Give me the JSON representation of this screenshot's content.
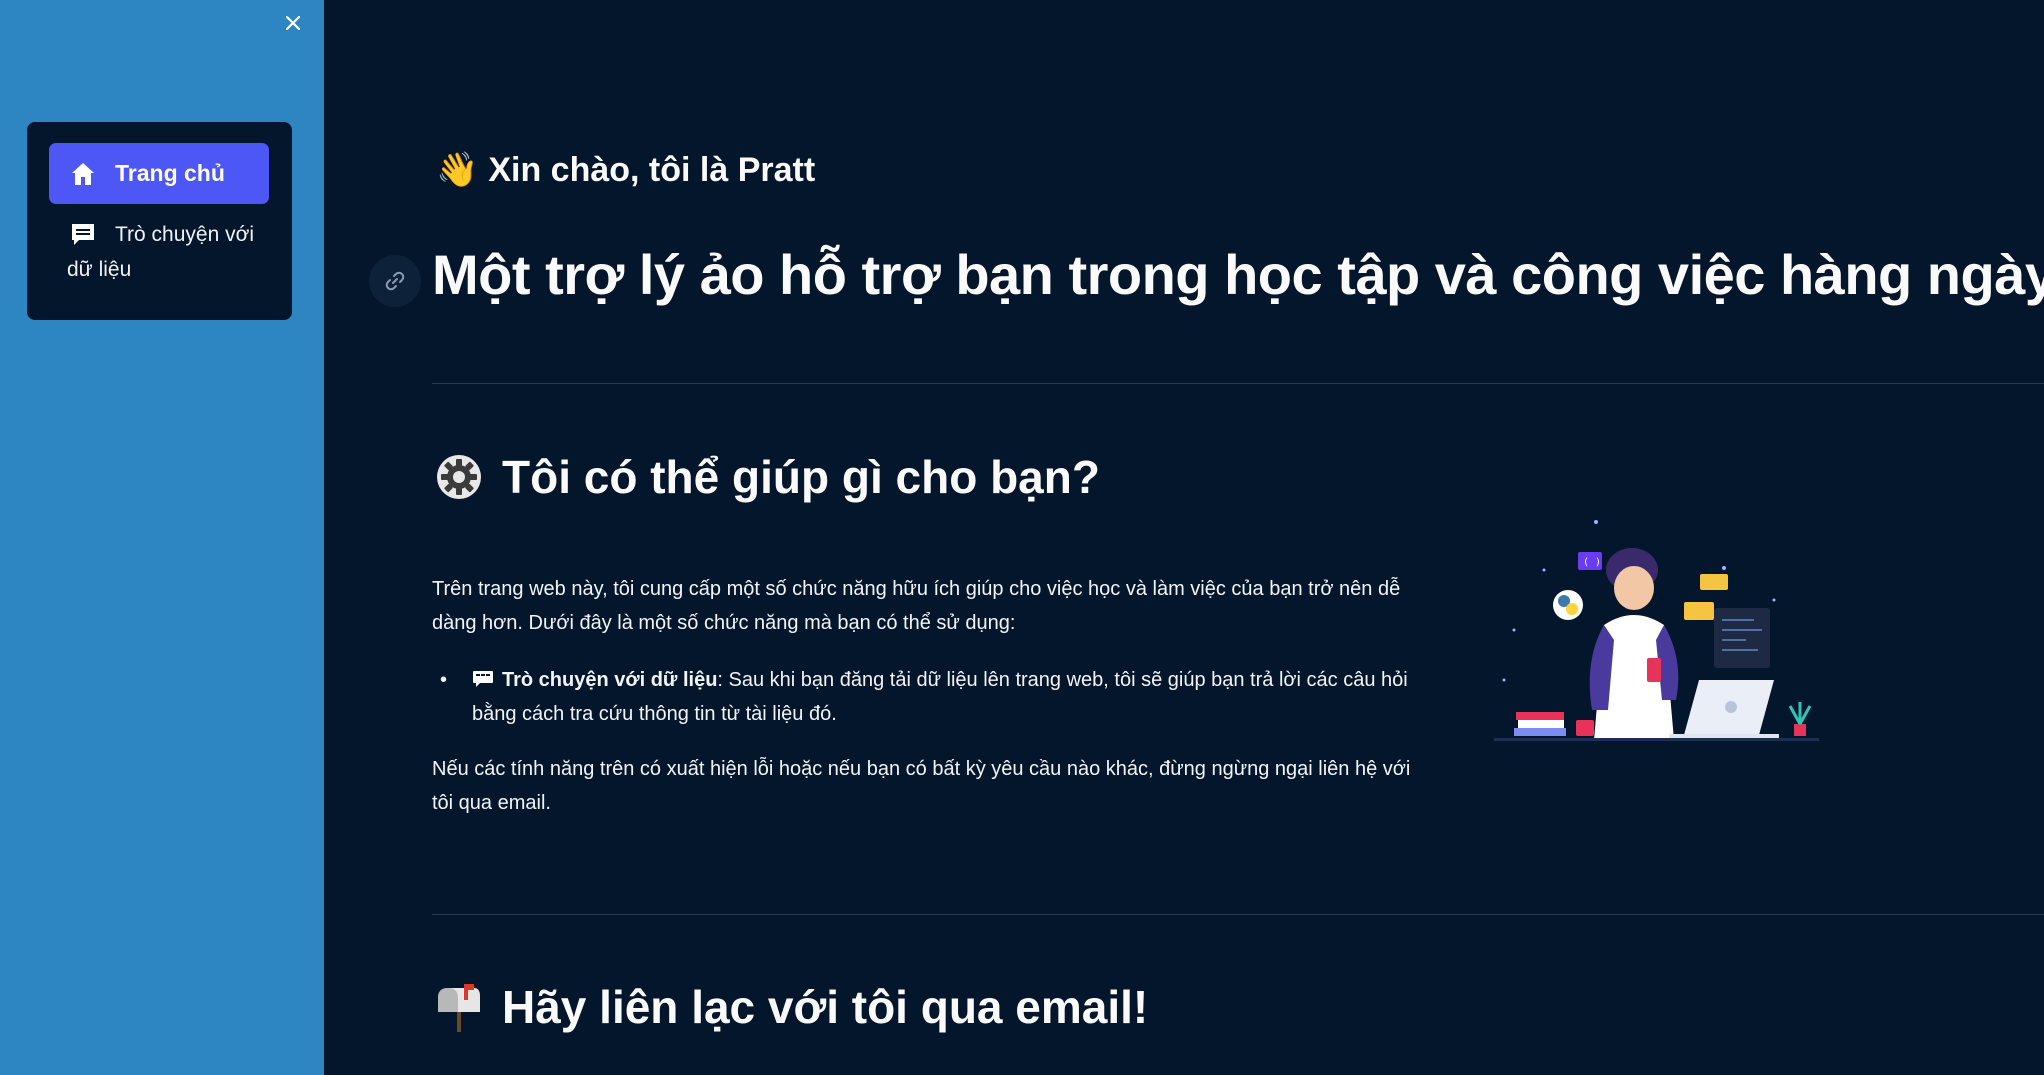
{
  "sidebar": {
    "close_icon": "close-icon",
    "items": [
      {
        "label": "Trang chủ",
        "icon": "home-icon",
        "active": true
      },
      {
        "label": "Trò chuyện với dữ liệu",
        "icon": "chat-icon",
        "active": false
      }
    ]
  },
  "main": {
    "greeting_emoji": "👋",
    "greeting": "Xin chào, tôi là Pratt",
    "title": "Một trợ lý ảo hỗ trợ bạn trong học tập và công việc hàng ngày",
    "section_help": {
      "icon": "gear-icon",
      "title": "Tôi có thể giúp gì cho bạn?"
    },
    "intro": "Trên trang web này, tôi cung cấp một số chức năng hữu ích giúp cho việc học và làm việc của bạn trở nên dễ dàng hơn. Dưới đây là một số chức năng mà bạn có thể sử dụng:",
    "features": [
      {
        "bullet": "•",
        "icon": "chat-icon",
        "name": "Trò chuyện với dữ liệu",
        "description": ": Sau khi bạn đăng tải dữ liệu lên trang web, tôi sẽ giúp bạn trả lời các câu hỏi bằng cách tra cứu thông tin từ tài liệu đó."
      }
    ],
    "outro": "Nếu các tính năng trên có xuất hiện lỗi hoặc nếu bạn có bất kỳ yêu cầu nào khác, đừng ngừng ngại liên hệ với tôi qua email.",
    "section_contact": {
      "icon": "mailbox-icon",
      "title": "Hãy liên lạc với tôi qua email!"
    }
  },
  "colors": {
    "sidebar_bg": "#2d86c1",
    "main_bg": "#04162c",
    "nav_active": "#4c57f5"
  }
}
